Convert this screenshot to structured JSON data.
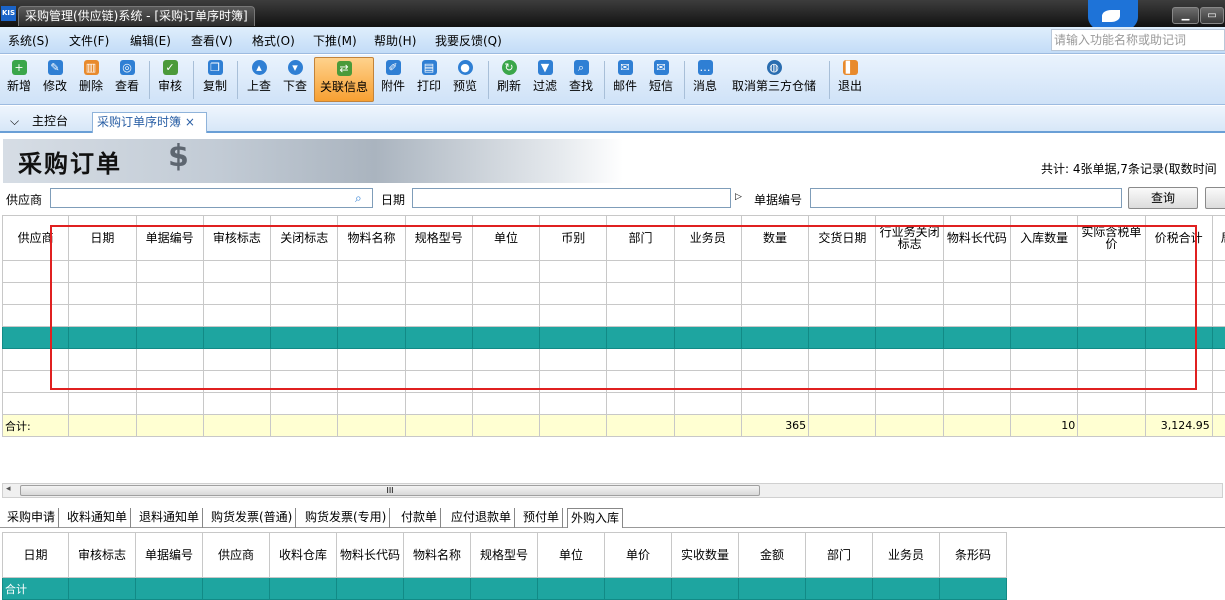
{
  "window": {
    "title": "采购管理(供应链)系统 - [采购订单序时簿]",
    "logo": "KIS"
  },
  "menu": {
    "items": [
      "系统(S)",
      "文件(F)",
      "编辑(E)",
      "查看(V)",
      "格式(O)",
      "下推(M)",
      "帮助(H)",
      "我要反馈(Q)"
    ],
    "search_placeholder": "请输入功能名称或助记词"
  },
  "toolbar": {
    "buttons": [
      {
        "label": "新增",
        "icon": "add-icon",
        "color": "#3aa64a"
      },
      {
        "label": "修改",
        "icon": "edit-icon",
        "color": "#2f7fd4"
      },
      {
        "label": "删除",
        "icon": "delete-icon",
        "color": "#e88a2c"
      },
      {
        "label": "查看",
        "icon": "view-icon",
        "color": "#2f7fd4"
      },
      {
        "label": "审核",
        "icon": "approve-icon",
        "color": "#4b9a3a"
      },
      {
        "label": "复制",
        "icon": "copy-icon",
        "color": "#2f7fd4"
      },
      {
        "label": "上查",
        "icon": "trace-up-icon",
        "color": "#2f7fd4"
      },
      {
        "label": "下查",
        "icon": "trace-down-icon",
        "color": "#2f7fd4"
      },
      {
        "label": "关联信息",
        "icon": "related-info-icon",
        "color": "#4b9a3a"
      },
      {
        "label": "附件",
        "icon": "attachment-icon",
        "color": "#2f7fd4"
      },
      {
        "label": "打印",
        "icon": "print-icon",
        "color": "#2f7fd4"
      },
      {
        "label": "预览",
        "icon": "preview-icon",
        "color": "#2f7fd4"
      },
      {
        "label": "刷新",
        "icon": "refresh-icon",
        "color": "#3aa64a"
      },
      {
        "label": "过滤",
        "icon": "filter-icon",
        "color": "#2f7fd4"
      },
      {
        "label": "查找",
        "icon": "find-icon",
        "color": "#2f7fd4"
      },
      {
        "label": "邮件",
        "icon": "mail-icon",
        "color": "#2f7fd4"
      },
      {
        "label": "短信",
        "icon": "sms-icon",
        "color": "#2f7fd4"
      },
      {
        "label": "消息",
        "icon": "message-icon",
        "color": "#2f7fd4"
      },
      {
        "label": "取消第三方仓储",
        "icon": "globe-icon",
        "color": "#2a6db0"
      },
      {
        "label": "退出",
        "icon": "exit-icon",
        "color": "#e88a2c"
      }
    ]
  },
  "tabs": {
    "home": "主控台",
    "active": "采购订单序时簿",
    "close": "×"
  },
  "page": {
    "title": "采购订单",
    "stats": "共计: 4张单据,7条记录(取数时间"
  },
  "filter": {
    "supplier_label": "供应商",
    "date_label": "日期",
    "bill_label": "单据编号",
    "query": "查询"
  },
  "grid": {
    "headers": [
      "供应商",
      "日期",
      "单据编号",
      "审核标志",
      "关闭标志",
      "物料名称",
      "规格型号",
      "单位",
      "币别",
      "部门",
      "业务员",
      "数量",
      "交货日期",
      "行业务关闭标志",
      "物料长代码",
      "入库数量",
      "实际含税单价",
      "价税合计",
      "局"
    ],
    "total_label": "合计:",
    "totals": {
      "quantity": "365",
      "in_qty": "10",
      "amount": "3,124.95"
    }
  },
  "bottom_tabs": [
    "采购申请",
    "收料通知单",
    "退料通知单",
    "购货发票(普通)",
    "购货发票(专用)",
    "付款单",
    "应付退款单",
    "预付单",
    "外购入库"
  ],
  "detail": {
    "headers": [
      "日期",
      "审核标志",
      "单据编号",
      "供应商",
      "收料仓库",
      "物料长代码",
      "物料名称",
      "规格型号",
      "单位",
      "单价",
      "实收数量",
      "金额",
      "部门",
      "业务员",
      "条形码"
    ],
    "total_label": "合计"
  },
  "colors": {
    "selected_row": "#1ea5a0",
    "total_row": "#ffffd2",
    "highlight_box": "#e02020",
    "active_tool": "#f7a032"
  }
}
